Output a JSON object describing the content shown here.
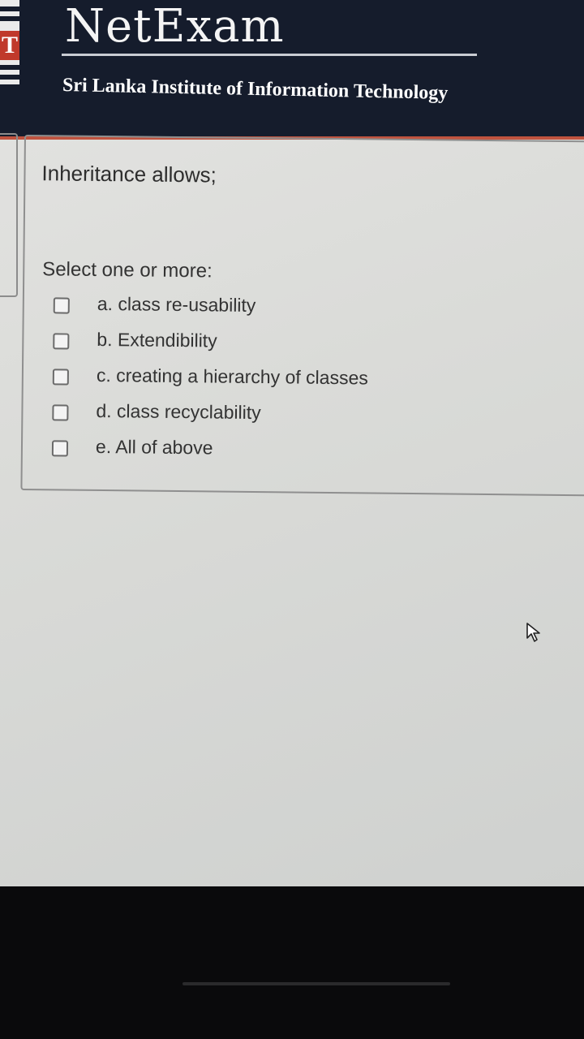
{
  "header": {
    "app_title": "NetExam",
    "institute": "Sri Lanka Institute of Information Technology",
    "logo_letter": "T"
  },
  "question": {
    "text": "Inheritance allows;",
    "prompt": "Select one or more:",
    "options": [
      {
        "label": "a. class re-usability",
        "checked": false
      },
      {
        "label": "b. Extendibility",
        "checked": false
      },
      {
        "label": "c. creating a hierarchy of classes",
        "checked": false
      },
      {
        "label": "d. class recyclability",
        "checked": false
      },
      {
        "label": "e. All of above",
        "checked": false
      }
    ]
  },
  "icons": {
    "cursor": "mouse-pointer-icon",
    "logo": "sliit-logo-icon",
    "checkbox": "checkbox-icon"
  },
  "colors": {
    "header_bg": "#151c2c",
    "accent_stripe": "#c0533f",
    "logo_red": "#c0392b"
  }
}
